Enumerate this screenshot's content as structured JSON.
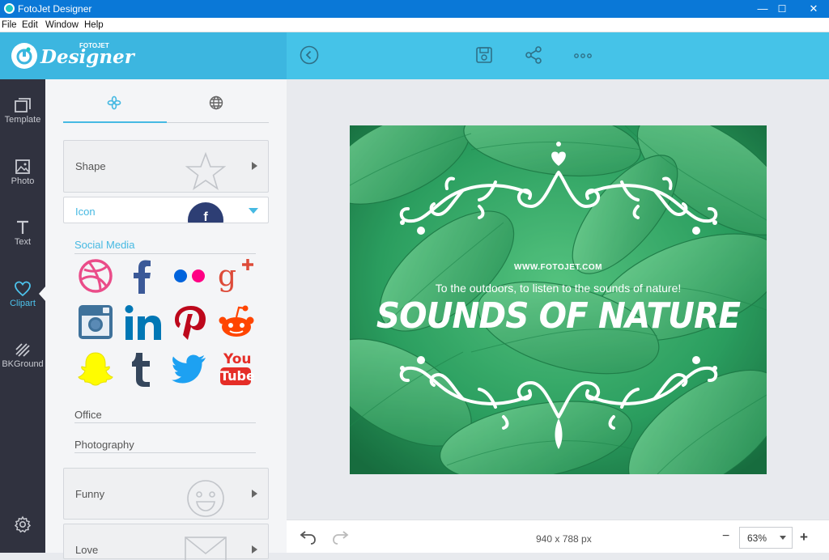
{
  "window": {
    "title": "FotoJet Designer",
    "minimize": "—",
    "maximize": "☐",
    "close": "✕"
  },
  "menu": [
    "File",
    "Edit",
    "Window",
    "Help"
  ],
  "logo": {
    "brand_small": "FOTOJET",
    "brand": "Designer"
  },
  "toolbar": {
    "back_icon": "back-circle-icon",
    "save_icon": "save-icon",
    "share_icon": "share-icon",
    "more_icon": "more-icon"
  },
  "nav": [
    {
      "label": "Template",
      "icon": "template-icon"
    },
    {
      "label": "Photo",
      "icon": "photo-icon"
    },
    {
      "label": "Text",
      "icon": "text-icon"
    },
    {
      "label": "Clipart",
      "icon": "heart-icon",
      "active": true
    },
    {
      "label": "BKGround",
      "icon": "background-icon"
    }
  ],
  "panel": {
    "tabs": [
      {
        "icon": "flower-icon",
        "active": true
      },
      {
        "icon": "globe-icon"
      }
    ],
    "categories": {
      "shape": "Shape",
      "icon": "Icon",
      "funny": "Funny",
      "love": "Love"
    },
    "icon_sections": {
      "social_media": "Social Media",
      "office": "Office",
      "photography": "Photography"
    },
    "social_icons": [
      "dribbble",
      "facebook",
      "flickr",
      "google-plus",
      "instagram",
      "linkedin",
      "pinterest",
      "reddit",
      "snapchat",
      "tumblr",
      "twitter",
      "youtube"
    ],
    "youtube_text": {
      "you": "You",
      "tube": "Tube"
    },
    "facebook_badge": "f"
  },
  "design": {
    "website": "WWW.FOTOJET.COM",
    "subtitle": "To the outdoors, to listen to the sounds of nature!",
    "headline": "SOUNDS OF NATURE"
  },
  "bottom": {
    "dimensions": "940 x 788 px",
    "zoom": "63%",
    "zoom_minus": "−",
    "zoom_plus": "+"
  },
  "colors": {
    "accent": "#45c3e8",
    "nav_bg": "#30323f",
    "active": "#4dc3ec"
  }
}
